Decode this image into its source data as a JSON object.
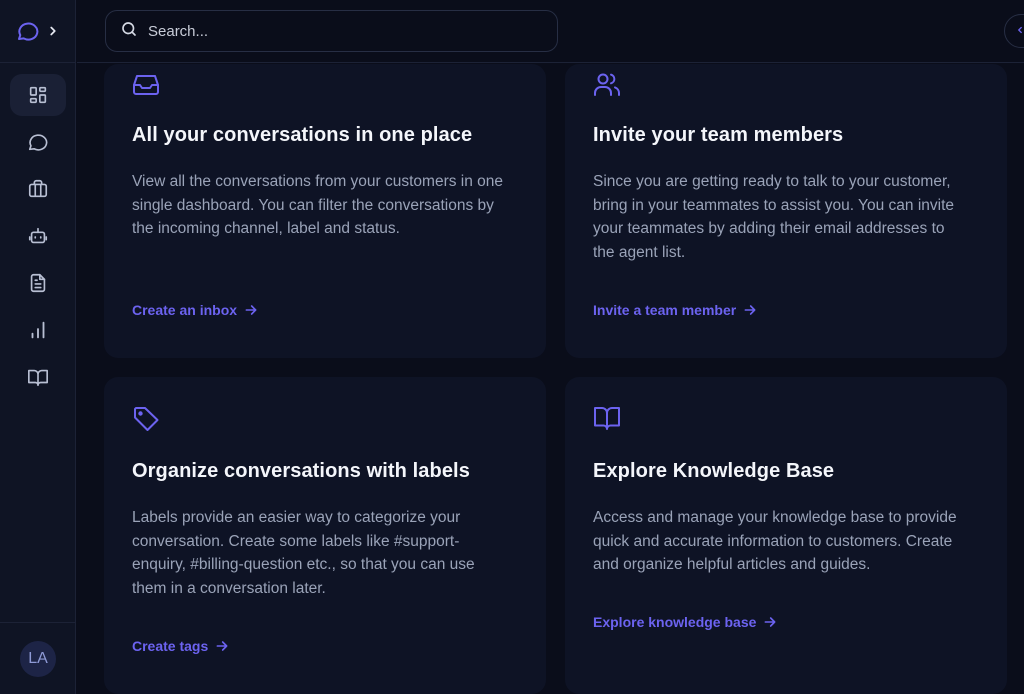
{
  "sidebar": {
    "logo_icon": "chat-bubble-icon",
    "expand_icon": "chevron-right-icon",
    "items": [
      {
        "name": "dashboard",
        "icon": "grid-icon",
        "active": true
      },
      {
        "name": "conversations",
        "icon": "chat-icon",
        "active": false
      },
      {
        "name": "contacts",
        "icon": "briefcase-icon",
        "active": false
      },
      {
        "name": "bots",
        "icon": "robot-icon",
        "active": false
      },
      {
        "name": "reports",
        "icon": "document-icon",
        "active": false
      },
      {
        "name": "analytics",
        "icon": "bar-chart-icon",
        "active": false
      },
      {
        "name": "knowledge-base",
        "icon": "book-icon",
        "active": false
      }
    ],
    "avatar_initials": "LA"
  },
  "header": {
    "search_placeholder": "Search..."
  },
  "colors": {
    "accent": "#6c63f0",
    "background": "#0a0d1a",
    "card": "#0e1325",
    "text_primary": "#f4f6fb",
    "text_secondary": "#9aa3b8"
  },
  "cards": [
    {
      "icon": "inbox-icon",
      "title": "All your conversations in one place",
      "description": "View all the conversations from your customers in one single dashboard. You can filter the conversations by the incoming channel, label and status.",
      "link": "Create an inbox"
    },
    {
      "icon": "users-icon",
      "title": "Invite your team members",
      "description": "Since you are getting ready to talk to your customer, bring in your teammates to assist you. You can invite your teammates by adding their email addresses to the agent list.",
      "link": "Invite a team member"
    },
    {
      "icon": "tag-icon",
      "title": "Organize conversations with labels",
      "description": "Labels provide an easier way to categorize your conversation. Create some labels like #support-enquiry, #billing-question etc., so that you can use them in a conversation later.",
      "link": "Create tags"
    },
    {
      "icon": "book-open-icon",
      "title": "Explore Knowledge Base",
      "description": "Access and manage your knowledge base to provide quick and accurate information to customers. Create and organize helpful articles and guides.",
      "link": "Explore knowledge base"
    }
  ]
}
